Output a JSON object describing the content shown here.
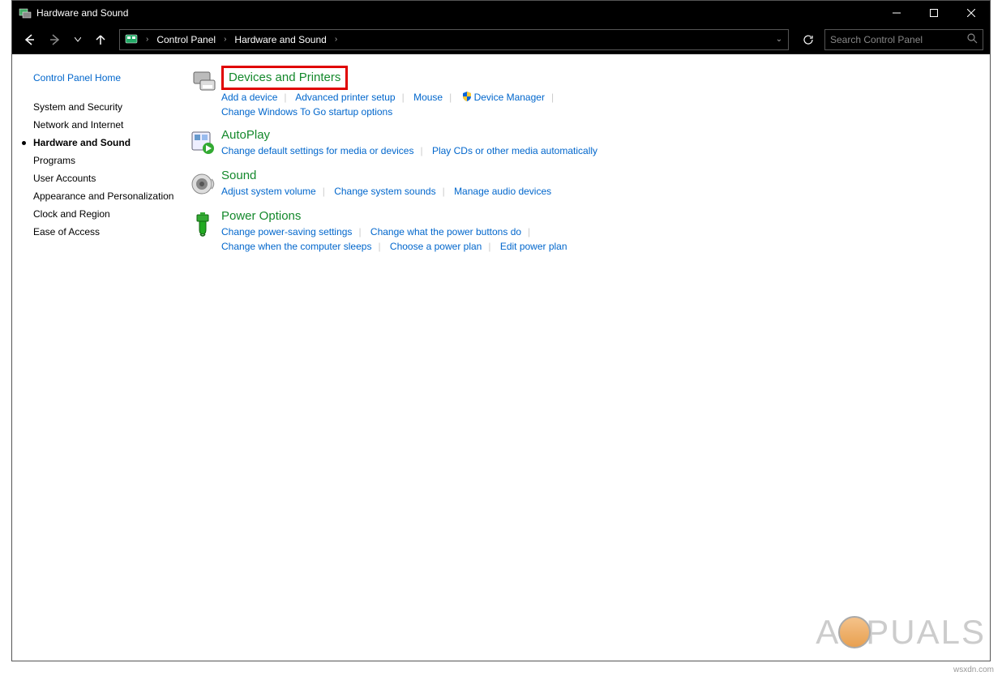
{
  "window": {
    "title": "Hardware and Sound"
  },
  "breadcrumb": {
    "items": [
      "Control Panel",
      "Hardware and Sound"
    ]
  },
  "search": {
    "placeholder": "Search Control Panel"
  },
  "sidebar": {
    "home": "Control Panel Home",
    "items": [
      {
        "label": "System and Security",
        "active": false
      },
      {
        "label": "Network and Internet",
        "active": false
      },
      {
        "label": "Hardware and Sound",
        "active": true
      },
      {
        "label": "Programs",
        "active": false
      },
      {
        "label": "User Accounts",
        "active": false
      },
      {
        "label": "Appearance and Personalization",
        "active": false
      },
      {
        "label": "Clock and Region",
        "active": false
      },
      {
        "label": "Ease of Access",
        "active": false
      }
    ]
  },
  "categories": [
    {
      "name": "Devices and Printers",
      "highlight": true,
      "links": [
        [
          "Add a device",
          "Advanced printer setup",
          "Mouse",
          "Device Manager"
        ],
        [
          "Change Windows To Go startup options"
        ]
      ],
      "shield_on": 3
    },
    {
      "name": "AutoPlay",
      "links": [
        [
          "Change default settings for media or devices",
          "Play CDs or other media automatically"
        ]
      ]
    },
    {
      "name": "Sound",
      "links": [
        [
          "Adjust system volume",
          "Change system sounds",
          "Manage audio devices"
        ]
      ]
    },
    {
      "name": "Power Options",
      "links": [
        [
          "Change power-saving settings",
          "Change what the power buttons do"
        ],
        [
          "Change when the computer sleeps",
          "Choose a power plan",
          "Edit power plan"
        ]
      ]
    }
  ],
  "watermark": {
    "text_before": "A",
    "text_after": "PUALS"
  },
  "source": "wsxdn.com"
}
